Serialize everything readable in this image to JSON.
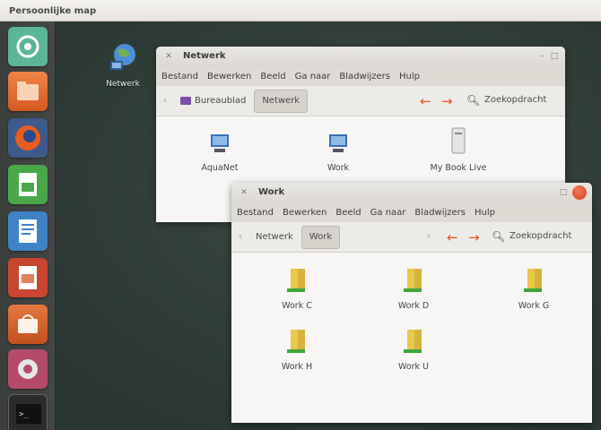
{
  "panel": {
    "title": "Persoonlijke map"
  },
  "launcher": {
    "items": [
      {
        "name": "dash-home",
        "color": "#5bb596"
      },
      {
        "name": "files",
        "color": "#e86b2e"
      },
      {
        "name": "firefox",
        "color": "#e95b20"
      },
      {
        "name": "libreoffice-calc",
        "color": "#48a848"
      },
      {
        "name": "libreoffice-writer",
        "color": "#3e83c5"
      },
      {
        "name": "libreoffice-impress",
        "color": "#c9452d"
      },
      {
        "name": "software-center",
        "color": "#d46a35"
      },
      {
        "name": "system-settings",
        "color": "#b44a6a"
      },
      {
        "name": "terminal",
        "color": "#333333"
      }
    ]
  },
  "desktop": {
    "icon_label": "Netwerk"
  },
  "window_back": {
    "title": "Netwerk",
    "menu": [
      "Bestand",
      "Bewerken",
      "Beeld",
      "Ga naar",
      "Bladwijzers",
      "Hulp"
    ],
    "crumbs": [
      "Bureaublad",
      "Netwerk"
    ],
    "search": "Zoekopdracht",
    "files": [
      "AquaNet",
      "Work",
      "My Book Live"
    ]
  },
  "window_front": {
    "title": "Work",
    "menu": [
      "Bestand",
      "Bewerken",
      "Beeld",
      "Ga naar",
      "Bladwijzers",
      "Hulp"
    ],
    "crumbs": [
      "Netwerk",
      "Work"
    ],
    "search": "Zoekopdracht",
    "files": [
      "Work C",
      "Work D",
      "Work G",
      "Work H",
      "Work U"
    ]
  }
}
